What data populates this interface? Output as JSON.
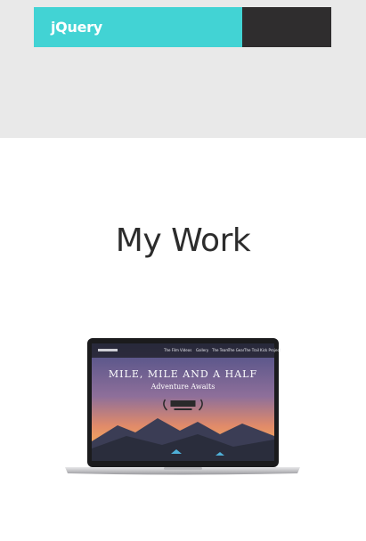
{
  "skills": [
    {
      "label": "jQuery",
      "level_percent": 70,
      "fill_color": "#42d3d4",
      "track_color": "#2f2d2e"
    }
  ],
  "work": {
    "title": "My Work",
    "items": [
      {
        "nav": [
          "The Film",
          "Videos",
          "Gallery",
          "The Team",
          "The Gear",
          "The Trail",
          "Kick Project"
        ],
        "heading": "MILE, MILE AND A HALF",
        "subheading": "Adventure Awaits"
      }
    ]
  }
}
